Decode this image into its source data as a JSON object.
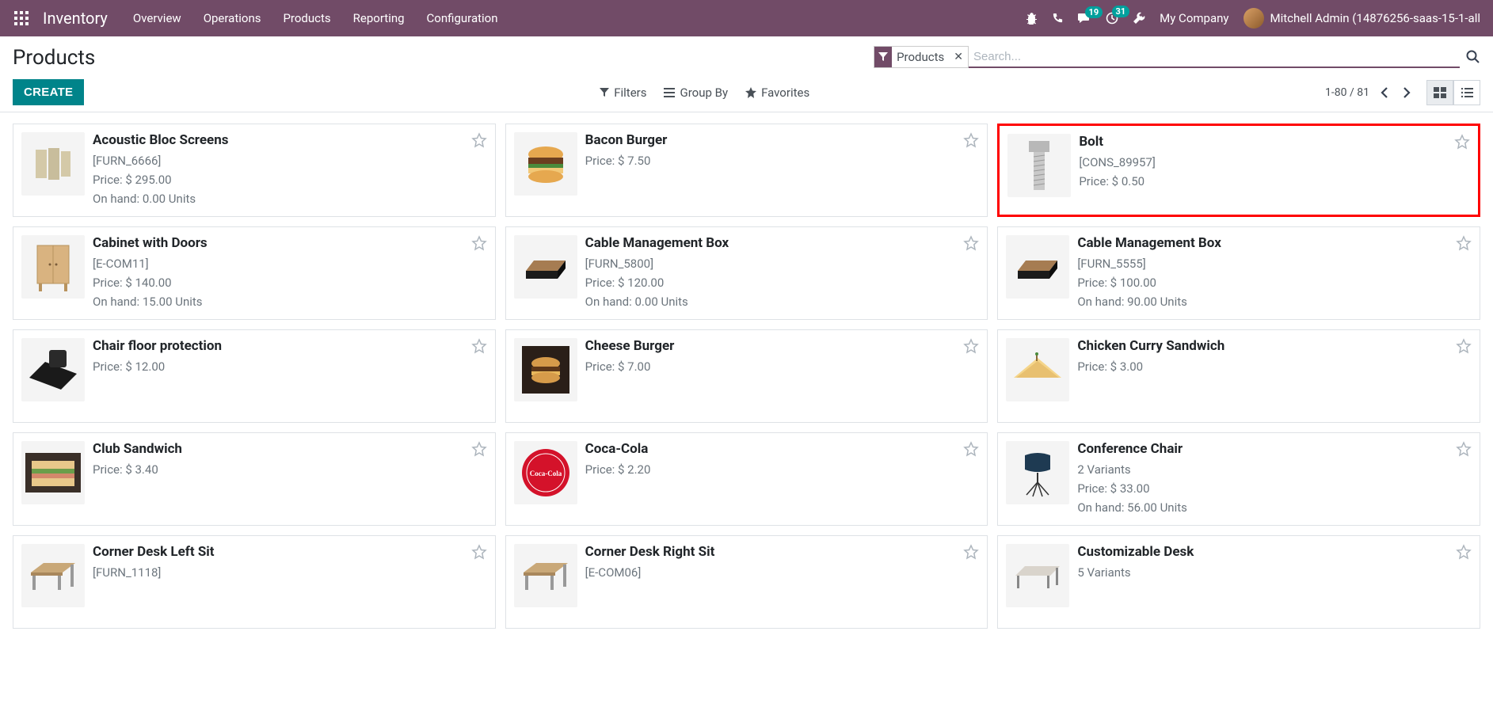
{
  "navbar": {
    "brand": "Inventory",
    "menu": [
      "Overview",
      "Operations",
      "Products",
      "Reporting",
      "Configuration"
    ],
    "messaging_badge": "19",
    "activity_badge": "31",
    "company": "My Company",
    "user": "Mitchell Admin (14876256-saas-15-1-all"
  },
  "control_panel": {
    "title": "Products",
    "create_label": "CREATE",
    "filter_tag": "Products",
    "search_placeholder": "Search...",
    "filters_label": "Filters",
    "groupby_label": "Group By",
    "favorites_label": "Favorites",
    "pager": "1-80 / 81"
  },
  "products": [
    {
      "name": "Acoustic Bloc Screens",
      "ref": "[FURN_6666]",
      "price": "Price: $ 295.00",
      "onhand": "On hand: 0.00 Units",
      "img": "screens",
      "highlighted": false
    },
    {
      "name": "Bacon Burger",
      "ref": "",
      "price": "Price: $ 7.50",
      "onhand": "",
      "img": "burger",
      "highlighted": false
    },
    {
      "name": "Bolt",
      "ref": "[CONS_89957]",
      "price": "Price: $ 0.50",
      "onhand": "",
      "img": "bolt",
      "highlighted": true
    },
    {
      "name": "Cabinet with Doors",
      "ref": "[E-COM11]",
      "price": "Price: $ 140.00",
      "onhand": "On hand: 15.00 Units",
      "img": "cabinet",
      "highlighted": false
    },
    {
      "name": "Cable Management Box",
      "ref": "[FURN_5800]",
      "price": "Price: $ 120.00",
      "onhand": "On hand: 0.00 Units",
      "img": "cablebox",
      "highlighted": false
    },
    {
      "name": "Cable Management Box",
      "ref": "[FURN_5555]",
      "price": "Price: $ 100.00",
      "onhand": "On hand: 90.00 Units",
      "img": "cablebox",
      "highlighted": false
    },
    {
      "name": "Chair floor protection",
      "ref": "",
      "price": "Price: $ 12.00",
      "onhand": "",
      "img": "mat",
      "highlighted": false
    },
    {
      "name": "Cheese Burger",
      "ref": "",
      "price": "Price: $ 7.00",
      "onhand": "",
      "img": "burger2",
      "highlighted": false
    },
    {
      "name": "Chicken Curry Sandwich",
      "ref": "",
      "price": "Price: $ 3.00",
      "onhand": "",
      "img": "sandwich",
      "highlighted": false
    },
    {
      "name": "Club Sandwich",
      "ref": "",
      "price": "Price: $ 3.40",
      "onhand": "",
      "img": "club",
      "highlighted": false
    },
    {
      "name": "Coca-Cola",
      "ref": "",
      "price": "Price: $ 2.20",
      "onhand": "",
      "img": "coke",
      "highlighted": false
    },
    {
      "name": "Conference Chair",
      "ref": "",
      "variants": "2 Variants",
      "price": "Price: $ 33.00",
      "onhand": "On hand: 56.00 Units",
      "img": "chair",
      "highlighted": false
    },
    {
      "name": "Corner Desk Left Sit",
      "ref": "[FURN_1118]",
      "price": "",
      "onhand": "",
      "img": "desk",
      "highlighted": false
    },
    {
      "name": "Corner Desk Right Sit",
      "ref": "[E-COM06]",
      "price": "",
      "onhand": "",
      "img": "desk",
      "highlighted": false
    },
    {
      "name": "Customizable Desk",
      "ref": "",
      "variants": "5 Variants",
      "price": "",
      "onhand": "",
      "img": "desk2",
      "highlighted": false
    }
  ]
}
